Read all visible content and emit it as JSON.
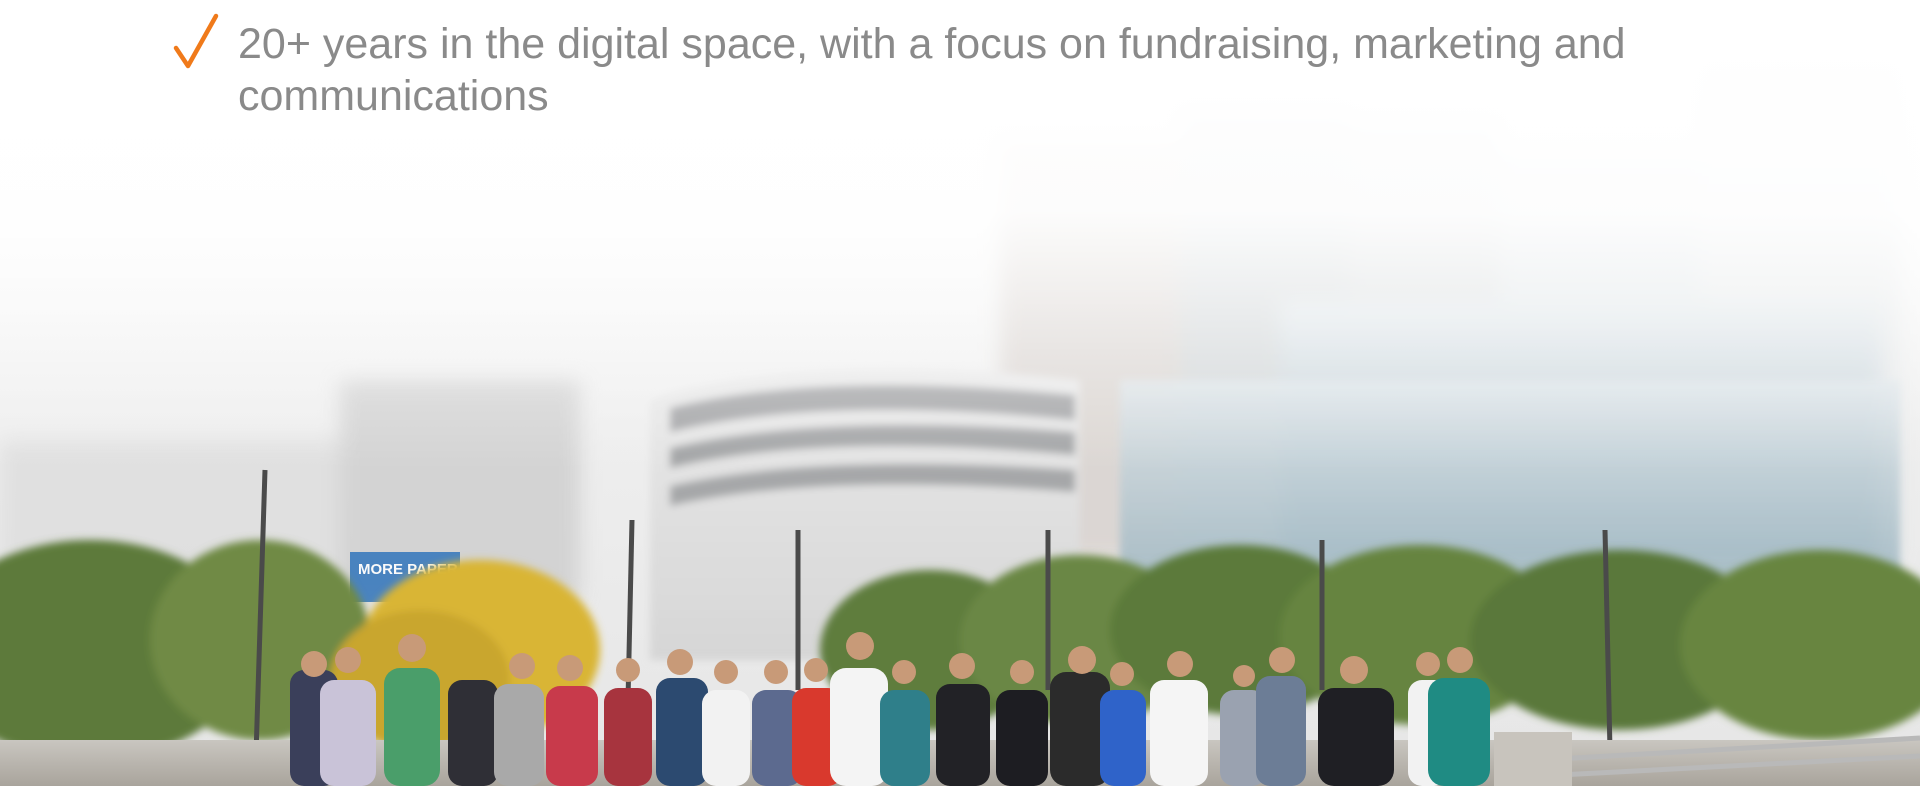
{
  "slide": {
    "bullet": {
      "icon": "checkmark-icon",
      "icon_color": "#F07A1A",
      "text": "20+ years in the digital space, with a focus on fundraising, marketing and communications",
      "text_color": "#8A8A8A"
    },
    "background": {
      "signage_text": "MORE PAPER"
    }
  }
}
